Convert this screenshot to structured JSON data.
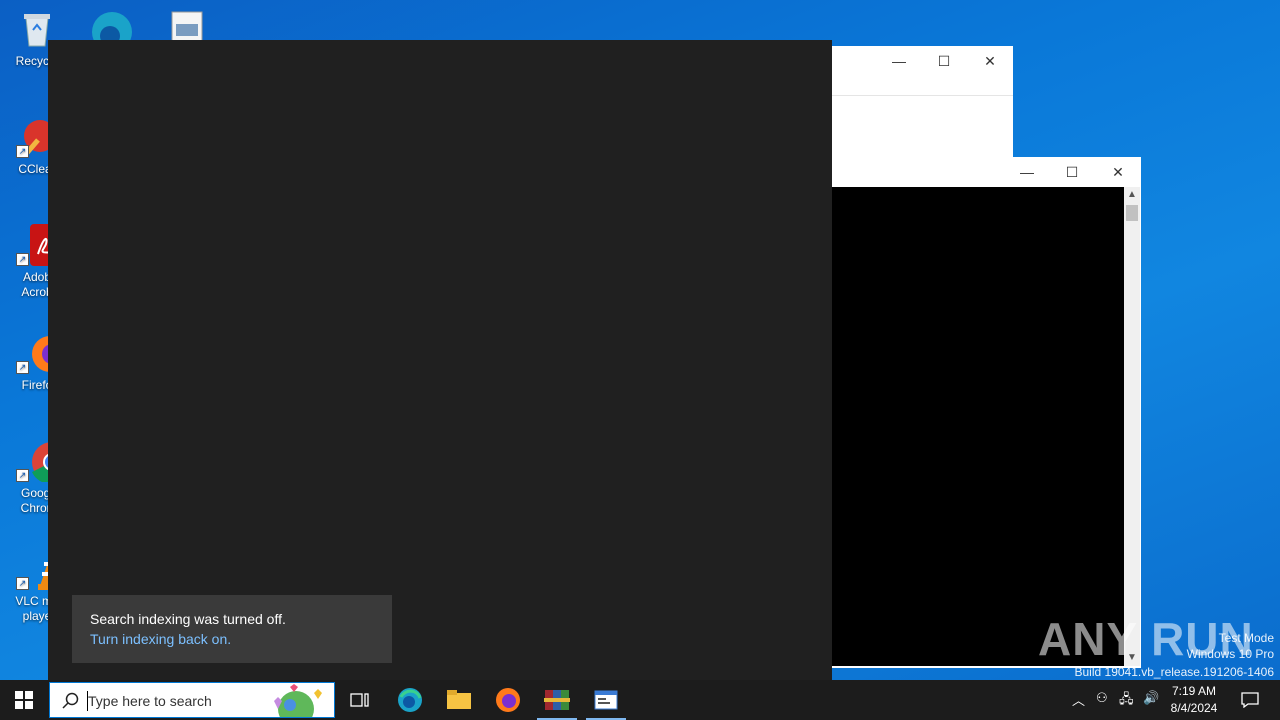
{
  "desktop": {
    "icons": [
      {
        "label": "Recycle"
      },
      {
        "label": "CClear"
      },
      {
        "label": "Adob\nAcrob"
      },
      {
        "label": "Firefo"
      },
      {
        "label": "Googl\nChron"
      },
      {
        "label": "VLC me\nplaye"
      }
    ]
  },
  "windows": {
    "minimize_glyph": "—",
    "maximize_glyph": "☐",
    "close_glyph": "✕"
  },
  "notification": {
    "title": "Search indexing was turned off.",
    "link": "Turn indexing back on."
  },
  "watermark": {
    "brand": "ANY RUN",
    "line1": "Test Mode",
    "line2": "Windows 10 Pro",
    "line3": "Build 19041.vb_release.191206-1406"
  },
  "taskbar": {
    "search_placeholder": "Type here to search",
    "time": "7:19 AM",
    "date": "8/4/2024"
  },
  "colors": {
    "desktop_blue": "#0a78d8",
    "panel_bg": "#202020",
    "toast_bg": "#3a3a3a",
    "link": "#7cc0ff",
    "taskbar_bg": "#1c1c1c"
  }
}
